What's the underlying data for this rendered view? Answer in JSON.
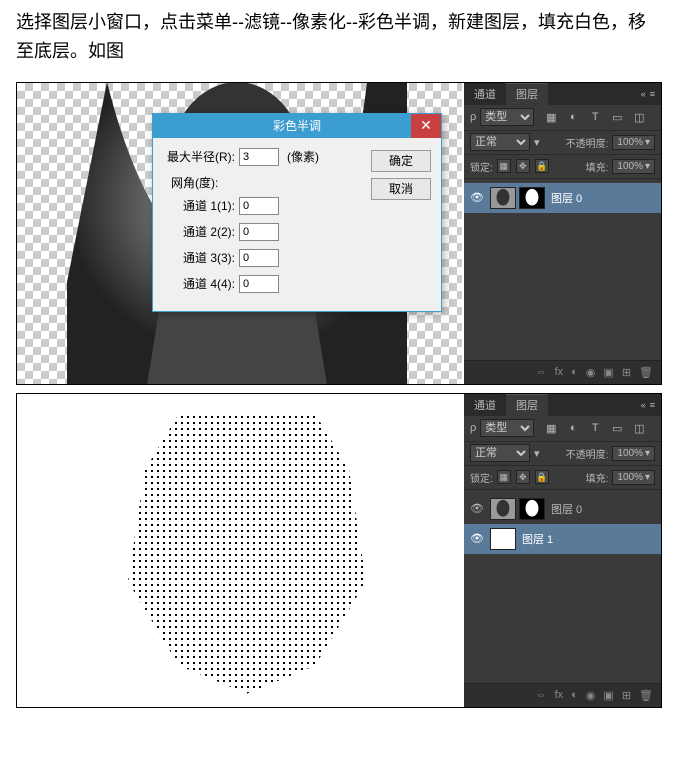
{
  "instruction": "选择图层小窗口，点击菜单--滤镜--像素化--彩色半调，新建图层，填充白色，移至底层。如图",
  "dialog": {
    "title": "彩色半调",
    "maxRadiusLabel": "最大半径(R):",
    "maxRadiusValue": "3",
    "unit": "(像素)",
    "gridAngleLabel": "网角(度):",
    "ch1Label": "通道 1(1):",
    "ch1Value": "0",
    "ch2Label": "通道 2(2):",
    "ch2Value": "0",
    "ch3Label": "通道 3(3):",
    "ch3Value": "0",
    "ch4Label": "通道 4(4):",
    "ch4Value": "0",
    "ok": "确定",
    "cancel": "取消"
  },
  "panel": {
    "tabChannels": "通道",
    "tabLayers": "图层",
    "kindOption": "类型",
    "blendOption": "正常",
    "opacityLabel": "不透明度:",
    "opacityValue": "100%",
    "lockLabel": "锁定:",
    "fillLabel": "填充:",
    "fillValue": "100%",
    "layer0": "图层 0",
    "layer1": "图层 1"
  },
  "icons": {
    "search": "ρ",
    "image": "▦",
    "adjust": "◐",
    "text": "T",
    "shape": "▭",
    "smart": "◫",
    "eye": "👁",
    "link": "⇔",
    "fx": "fx",
    "mask": "◐",
    "folder": "▣",
    "adjust2": "◉",
    "new": "⊞",
    "trash": "🗑",
    "dropdown": "▾",
    "menu": "≡",
    "collapse": "«"
  }
}
